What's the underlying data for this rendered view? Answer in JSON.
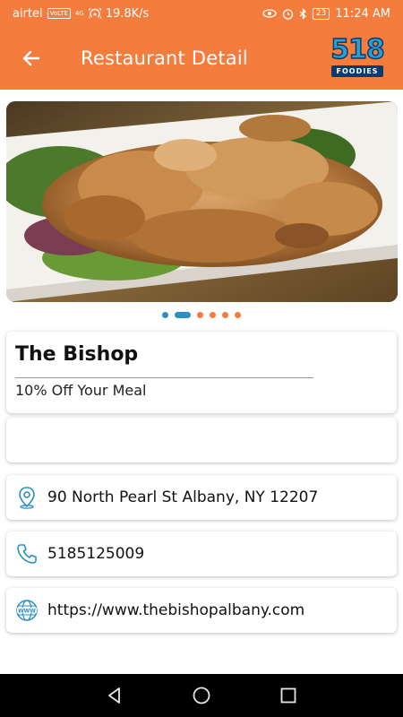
{
  "status_bar": {
    "carrier": "airtel",
    "volte": "VoLTE",
    "signal": "4G",
    "speed": "19.8K/s",
    "battery": "23",
    "time": "11:24 AM"
  },
  "app_bar": {
    "title": "Restaurant Detail",
    "back_icon": "arrow-left-icon",
    "logo_number": "518",
    "logo_text": "FOODIES"
  },
  "carousel": {
    "image": "fried-food-on-plate",
    "dot_count": 6,
    "active_index": 1
  },
  "restaurant": {
    "name": "The Bishop",
    "offer": "10% Off Your Meal"
  },
  "info": {
    "address": "90 North Pearl St Albany, NY 12207",
    "phone": "5185125009",
    "website": "https://www.thebishopalbany.com"
  },
  "colors": {
    "primary": "#f47c3c",
    "accent": "#2a8fc1",
    "nav": "#000000"
  },
  "nav_bar": {
    "icons": [
      "back-triangle-icon",
      "home-circle-icon",
      "recents-square-icon"
    ]
  }
}
